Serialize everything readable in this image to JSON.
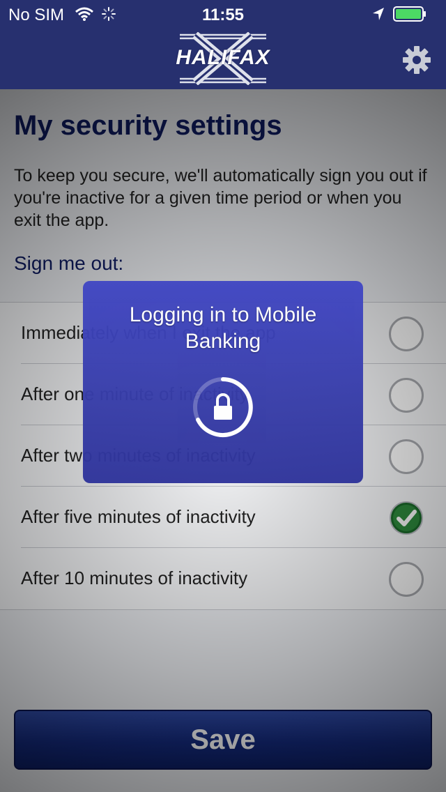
{
  "status_bar": {
    "carrier": "No SIM",
    "time": "11:55",
    "battery_color": "#4cd964"
  },
  "nav": {
    "logo_text": "HALIFAX",
    "settings_icon": "gear-icon",
    "background_color": "#27306f"
  },
  "page": {
    "title": "My security settings",
    "intro": "To keep you secure, we'll automatically sign you out if you're inactive for a given time period or when you exit the app.",
    "section_label": "Sign me out:"
  },
  "options": [
    {
      "label": "Immediately when I exit the app",
      "selected": false
    },
    {
      "label": "After one minute of inactivity",
      "selected": false
    },
    {
      "label": "After two minutes of inactivity",
      "selected": false
    },
    {
      "label": "After five minutes of inactivity",
      "selected": true
    },
    {
      "label": "After 10 minutes of inactivity",
      "selected": false
    }
  ],
  "save_label": "Save",
  "loading": {
    "message": "Logging in to Mobile Banking",
    "icon": "lock-icon"
  }
}
